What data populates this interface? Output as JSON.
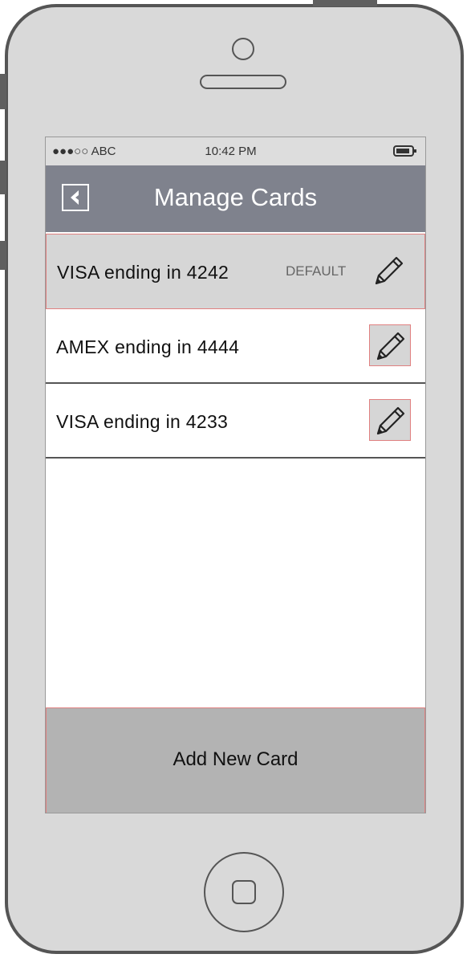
{
  "status_bar": {
    "carrier": "●●●○○ ABC",
    "time": "10:42 PM",
    "battery_icon": "battery-icon"
  },
  "nav": {
    "back_icon": "back-arrow-icon",
    "title": "Manage Cards"
  },
  "cards": [
    {
      "label": "VISA ending in 4242",
      "badge": "DEFAULT",
      "edit_icon": "pencil-icon"
    },
    {
      "label": "AMEX ending in 4444",
      "edit_icon": "pencil-icon"
    },
    {
      "label": "VISA ending in 4233",
      "edit_icon": "pencil-icon"
    }
  ],
  "footer": {
    "add_label": "Add New Card"
  },
  "colors": {
    "nav_bar": "#7f828d",
    "status_bar": "#dddddd",
    "selected_row": "#d6d6d6",
    "add_button": "#b3b3b3",
    "phone_body": "#d9d9d9",
    "highlight_border": "#e08080"
  }
}
